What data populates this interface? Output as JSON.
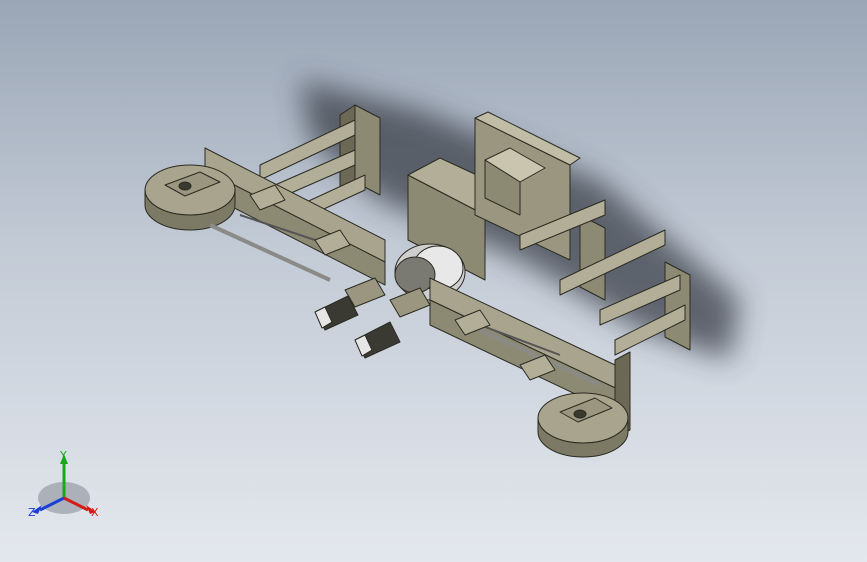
{
  "viewport": {
    "background_top": "#9aa6b6",
    "background_bottom": "#e4e8ee",
    "model_color": "#8d8a74",
    "model_light": "#b2ae98",
    "model_dark": "#6b6956",
    "edge_color": "#2b2b22"
  },
  "triad": {
    "x_label": "X",
    "y_label": "Y",
    "z_label": "Z",
    "x_color": "#d61a1a",
    "y_color": "#1aa81a",
    "z_color": "#1a3fd6"
  }
}
